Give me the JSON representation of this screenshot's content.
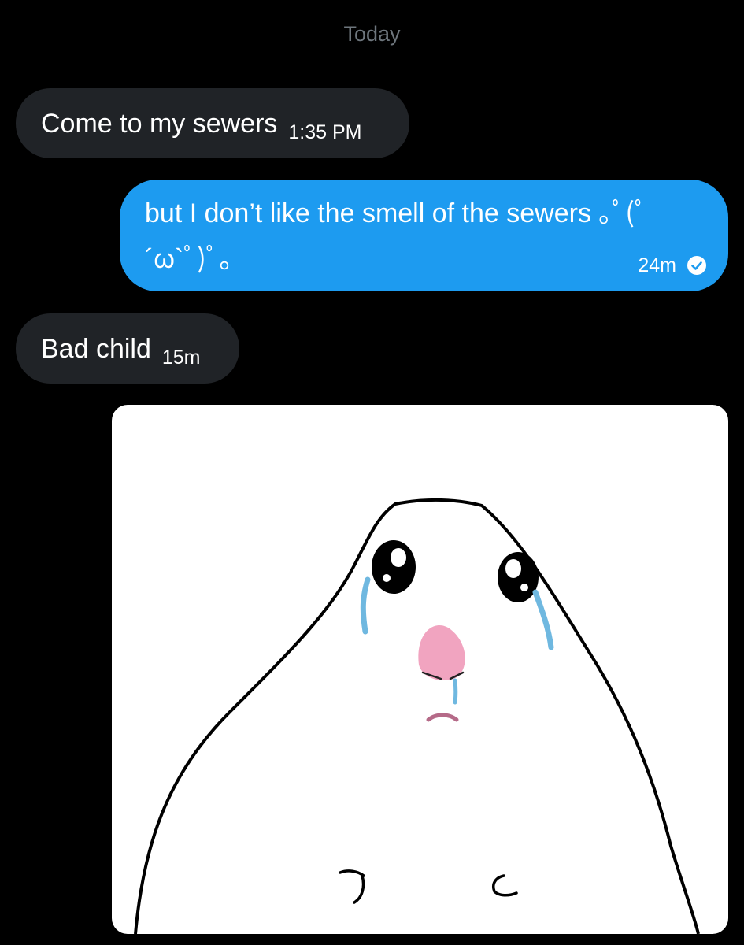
{
  "conversation": {
    "date_divider": "Today",
    "messages": [
      {
        "direction": "incoming",
        "text": "Come to my sewers",
        "time": "1:35 PM"
      },
      {
        "direction": "outgoing",
        "text": "but I don’t like the smell of the sewers ｡ﾟ(ﾟ´ω`ﾟ)ﾟ｡",
        "time": "24m",
        "status_icon": "check-circle-icon"
      },
      {
        "direction": "incoming",
        "text": "Bad child",
        "time": "15m"
      },
      {
        "direction": "incoming",
        "type": "image",
        "image_subject": "crying-hamster-meme"
      }
    ]
  },
  "colors": {
    "background": "#000000",
    "incoming_bubble": "#202327",
    "outgoing_bubble": "#1d9bf0",
    "date_divider": "#6e767d"
  }
}
